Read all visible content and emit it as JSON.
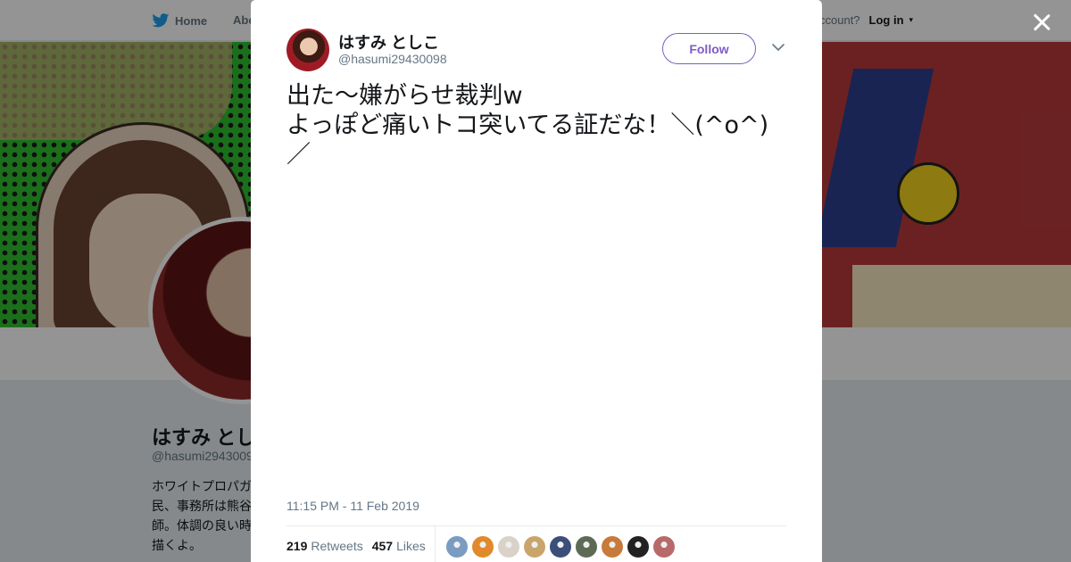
{
  "nav": {
    "home_label": "Home",
    "about_label": "Abo",
    "account_prompt": "ccount?",
    "login_label": "Log in"
  },
  "profile": {
    "name": "はすみ とし",
    "handle": "@hasumi2943009",
    "bio": "ホワイトプロパガ\n民、事務所は熊谷\n師。体調の良い時\n描くよ。"
  },
  "tweet": {
    "author_name": "はすみ としこ",
    "author_handle": "@hasumi29430098",
    "follow_label": "Follow",
    "text": "出た〜嫌がらせ裁判w\nよっぽど痛いトコ突いてる証だな！＼(^o^)\n／",
    "timestamp": "11:15 PM - 11 Feb 2019",
    "retweets_count": "219",
    "retweets_label": "Retweets",
    "likes_count": "457",
    "likes_label": "Likes",
    "liker_colors": [
      "#7a9cc0",
      "#e08a2b",
      "#d8d2c8",
      "#c9a56b",
      "#3b4f7a",
      "#5d6b55",
      "#c87a3a",
      "#222222",
      "#b86a6a"
    ]
  },
  "colors": {
    "follow_accent": "#7f5bc5",
    "twitter_blue": "#1da1f2",
    "overlay": "rgba(0,0,0,0.42)"
  },
  "icons": {
    "close": "close-icon",
    "caret": "chevron-down-icon",
    "logo": "twitter-bird-icon"
  }
}
